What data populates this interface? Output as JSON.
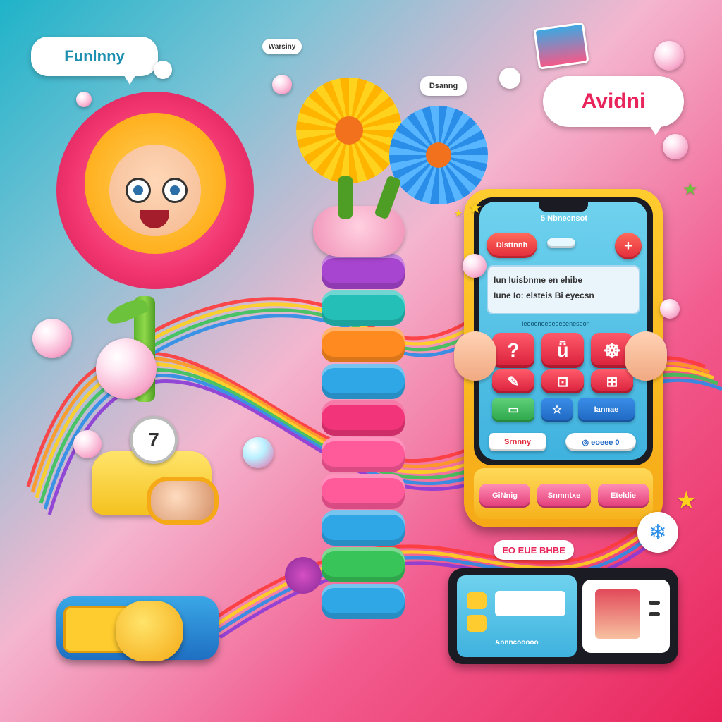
{
  "poster": {
    "bubble_left": "Funlnny",
    "bubble_top_center": "Warsiny",
    "bubble_mid": "Dsanng",
    "bubble_right": "Avidni"
  },
  "phone": {
    "header_label": "5 Nbnecnsot",
    "top_left_chip": "Dlsttnnh",
    "top_right_icon": "+",
    "message_line1": "Iun Iuisbnme en ehibe",
    "message_line2": "Iune Io: elsteis Bi eyecsn",
    "sub_caption": "Ieeoeneeeeeeceneseon",
    "keypad": [
      "?",
      "ǖ",
      "☸",
      "✎",
      "⊡",
      "⊞"
    ],
    "mid_buttons": [
      "▭",
      "☆",
      "Iannae"
    ],
    "bottom_left_label": "Srnnny",
    "bottom_right_label": "◎ eoeee 0",
    "bezel_buttons": [
      "GiNnig",
      "Snmntxe",
      "Eteldie"
    ]
  },
  "bottom_banner": "EO EUE BHBE",
  "second_device": {
    "caption": "Annncooooo"
  },
  "clock": {
    "face_numeral": "7"
  },
  "colors": {
    "accent_pink": "#e8245a",
    "accent_teal": "#1fb3c9",
    "flower_yellow": "#ffd21e",
    "flower_blue": "#2a8ee8"
  }
}
